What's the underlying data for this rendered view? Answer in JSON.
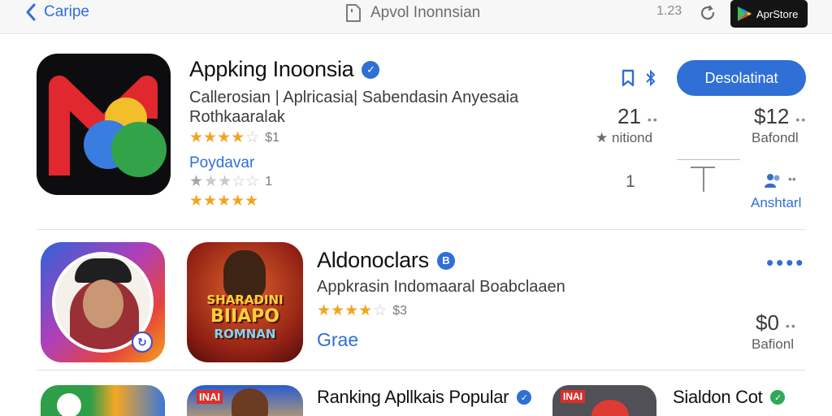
{
  "topbar": {
    "back_label": "Caripe",
    "address_text": "Apvol Inonnsian",
    "tab_count": "1.23",
    "store_badge_label": "AprStore"
  },
  "apps": [
    {
      "title": "Appking Inoonsia",
      "subtitle_line1": "Callerosian | Aplricasia| Sabendasin Anyesaia",
      "subtitle_line2": "Rothkaaralak",
      "rating_count": "$1",
      "publisher_label": "Poydavar",
      "stat_left_value": "21",
      "stat_left_caption": "nitiond",
      "stat_right_value": "$12",
      "stat_right_caption": "Bafondl",
      "stat_mid_value": "1",
      "share_caption": "Anshtarl",
      "get_button_label": "Desolatinat"
    },
    {
      "title": "Aldonoclars",
      "subtitle": "Appkrasin Indomaaral Boabclaaen",
      "rating_count": "$3",
      "category_label": "Grae",
      "price_value": "$0",
      "price_caption": "Bafionl",
      "icon_text_line1": "SHARADINI",
      "icon_text_line2": "BIIAPO",
      "icon_text_line3": "ROMNAN"
    },
    {
      "title": "Ranking Apllkais Popular",
      "badge_text_left": "INAI"
    },
    {
      "title": "Sialdon Cot"
    }
  ]
}
